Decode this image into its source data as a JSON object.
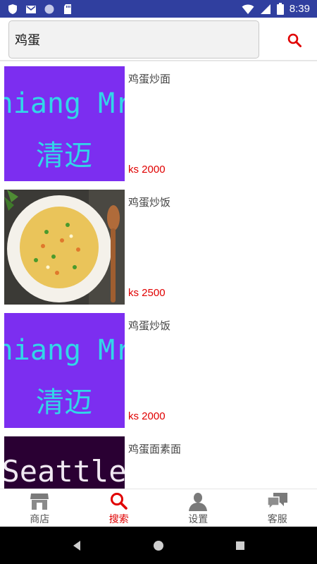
{
  "status_bar": {
    "time": "8:39"
  },
  "search": {
    "query": "鸡蛋"
  },
  "results": [
    {
      "name": "鸡蛋炒面",
      "price": "ks 2000",
      "thumb_text": [
        "Chiang Mrt",
        "清迈"
      ]
    },
    {
      "name": "鸡蛋炒饭",
      "price": "ks 2500"
    },
    {
      "name": "鸡蛋炒饭",
      "price": "ks 2000",
      "thumb_text": [
        "Chiang Mrt",
        "清迈"
      ]
    },
    {
      "name": "鸡蛋面素面",
      "price": "",
      "thumb_text": [
        "Seattle"
      ]
    }
  ],
  "nav": {
    "items": [
      {
        "label": "商店",
        "icon": "store-icon"
      },
      {
        "label": "搜索",
        "icon": "search-icon"
      },
      {
        "label": "设置",
        "icon": "user-icon"
      },
      {
        "label": "客服",
        "icon": "chat-icon"
      }
    ]
  },
  "colors": {
    "status_bar": "#303f9f",
    "accent": "#e00000",
    "thumb_purple": "#7c2ef0",
    "thumb_text": "#32d6e8"
  }
}
